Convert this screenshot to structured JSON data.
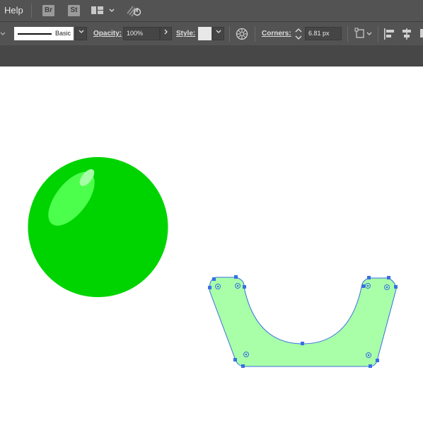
{
  "menubar": {
    "help_label": "Help",
    "bridge_label": "Br",
    "stock_label": "St"
  },
  "control_bar": {
    "stroke_style_label": "Basic",
    "opacity_label": "Opacity:",
    "opacity_value": "100%",
    "style_label": "Style:",
    "corners_label": "Corners:",
    "corners_value": "6.81 px"
  },
  "canvas": {
    "sphere_color": "#00d400",
    "sphere_highlight_color": "#4dff4d",
    "shape_fill_color": "#a8ffa8",
    "selection_color": "#3a6fe0",
    "background_color": "#ffffff"
  },
  "icons": [
    "bridge-icon",
    "stock-icon",
    "workspace-layout-icon",
    "gpu-performance-icon",
    "recolor-artwork-icon",
    "corner-spinner-icon",
    "transform-icon",
    "align-left-icon",
    "align-center-icon"
  ]
}
